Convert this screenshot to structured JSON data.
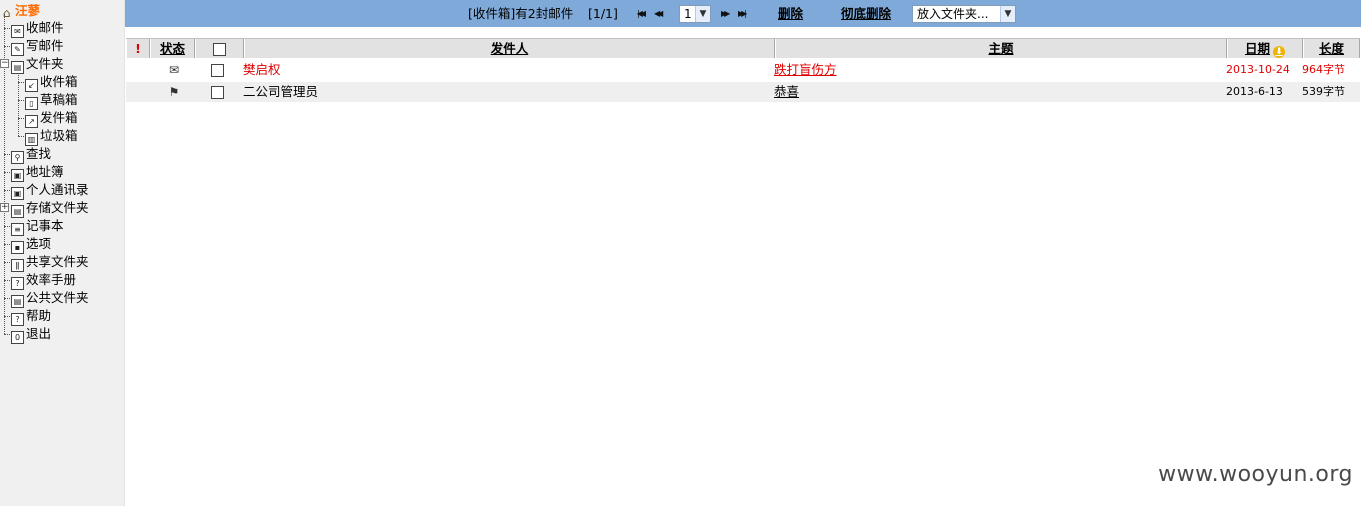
{
  "sidebar": {
    "root": {
      "label": "汪蓼",
      "icon": "home-icon"
    },
    "items": [
      {
        "label": "收邮件",
        "icon": "inbox-icon"
      },
      {
        "label": "写邮件",
        "icon": "compose-icon"
      },
      {
        "label": "文件夹",
        "icon": "folder-icon"
      },
      {
        "label": "收件箱",
        "icon": "inbox-folder-icon"
      },
      {
        "label": "草稿箱",
        "icon": "drafts-icon"
      },
      {
        "label": "发件箱",
        "icon": "outbox-icon"
      },
      {
        "label": "垃圾箱",
        "icon": "trash-icon"
      },
      {
        "label": "查找",
        "icon": "search-icon"
      },
      {
        "label": "地址簿",
        "icon": "address-book-icon"
      },
      {
        "label": "个人通讯录",
        "icon": "contacts-icon"
      },
      {
        "label": "存储文件夹",
        "icon": "storage-folder-icon"
      },
      {
        "label": "记事本",
        "icon": "notepad-icon"
      },
      {
        "label": "选项",
        "icon": "options-icon"
      },
      {
        "label": "共享文件夹",
        "icon": "shared-folder-icon"
      },
      {
        "label": "效率手册",
        "icon": "handbook-icon"
      },
      {
        "label": "公共文件夹",
        "icon": "public-folder-icon"
      },
      {
        "label": "帮助",
        "icon": "help-icon"
      },
      {
        "label": "退出",
        "icon": "logout-icon"
      }
    ]
  },
  "toolbar": {
    "summary": "[收件箱]有2封邮件",
    "page_info": "[1/1]",
    "page_select": "1",
    "delete_label": "删除",
    "purge_label": "彻底删除",
    "move_to_folder": "放入文件夹..."
  },
  "table": {
    "headers": {
      "flag": "!",
      "status": "状态",
      "sender": "发件人",
      "subject": "主题",
      "date": "日期",
      "size": "长度"
    },
    "rows": [
      {
        "status_icon": "envelope-icon",
        "sender": "樊启权",
        "subject": "跌打盲伤方",
        "date": "2013-10-24",
        "size": "964字节",
        "unread": true
      },
      {
        "status_icon": "flag-icon",
        "sender": "二公司管理员",
        "subject": "恭喜",
        "date": "2013-6-13",
        "size": "539字节",
        "unread": false
      }
    ]
  },
  "watermark": "www.wooyun.org",
  "colors": {
    "toolbar_bg": "#7fa9d8",
    "unread_text": "#e00000",
    "root_label": "#ff6a00",
    "sidebar_bg": "#f0f0f0"
  }
}
